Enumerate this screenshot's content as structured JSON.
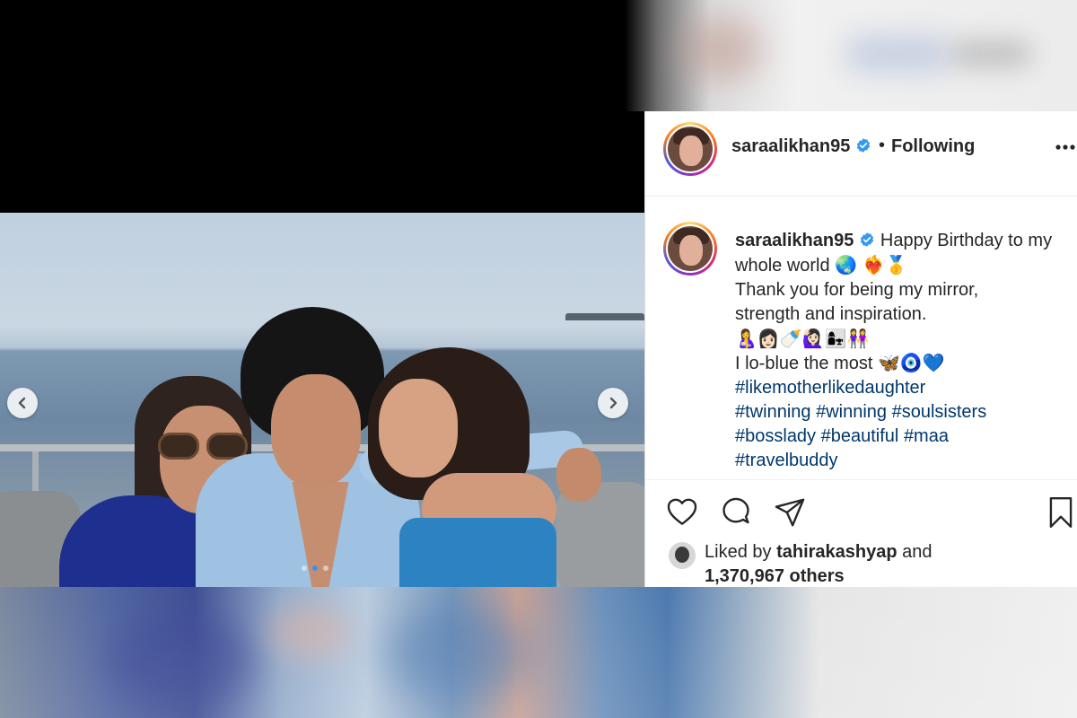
{
  "post": {
    "username": "saraalikhan95",
    "follow_separator": "•",
    "follow_status": "Following",
    "caption": {
      "text_1": "Happy Birthday to my",
      "text_2": "whole world",
      "emoji_2": "🌏 ❤️‍🔥🥇",
      "text_3": "Thank you for being my mirror,",
      "text_4": "strength and inspiration.",
      "emoji_5": "🤱👩🏻🍼🙋🏻‍♀️👩‍👧👭",
      "text_6": "I lo-blue the most",
      "emoji_6": "🦋🧿💙",
      "hashtag_1": "#likemotherlikedaughter",
      "hashtag_2": "#twinning",
      "hashtag_3": "#winning",
      "hashtag_4": "#soulsisters",
      "hashtag_5": "#bosslady",
      "hashtag_6": "#beautiful",
      "hashtag_7": "#maa",
      "hashtag_8": "#travelbuddy"
    },
    "likes": {
      "prefix": "Liked by",
      "liker": "tahirakashyap",
      "and": "and",
      "others": "1,370,967 others"
    }
  },
  "carousel": {
    "slide_count": 3,
    "active_slide": 1
  },
  "icons": {
    "prev": "chevron-left-icon",
    "next": "chevron-right-icon",
    "more": "more-options-icon",
    "verified": "verified-badge-icon",
    "like": "heart-icon",
    "comment": "comment-icon",
    "share": "send-icon",
    "save": "bookmark-icon"
  },
  "colors": {
    "verified": "#3897f0",
    "hashtag": "#00376b",
    "text": "#262626",
    "active_dot": "#3d91f0"
  }
}
